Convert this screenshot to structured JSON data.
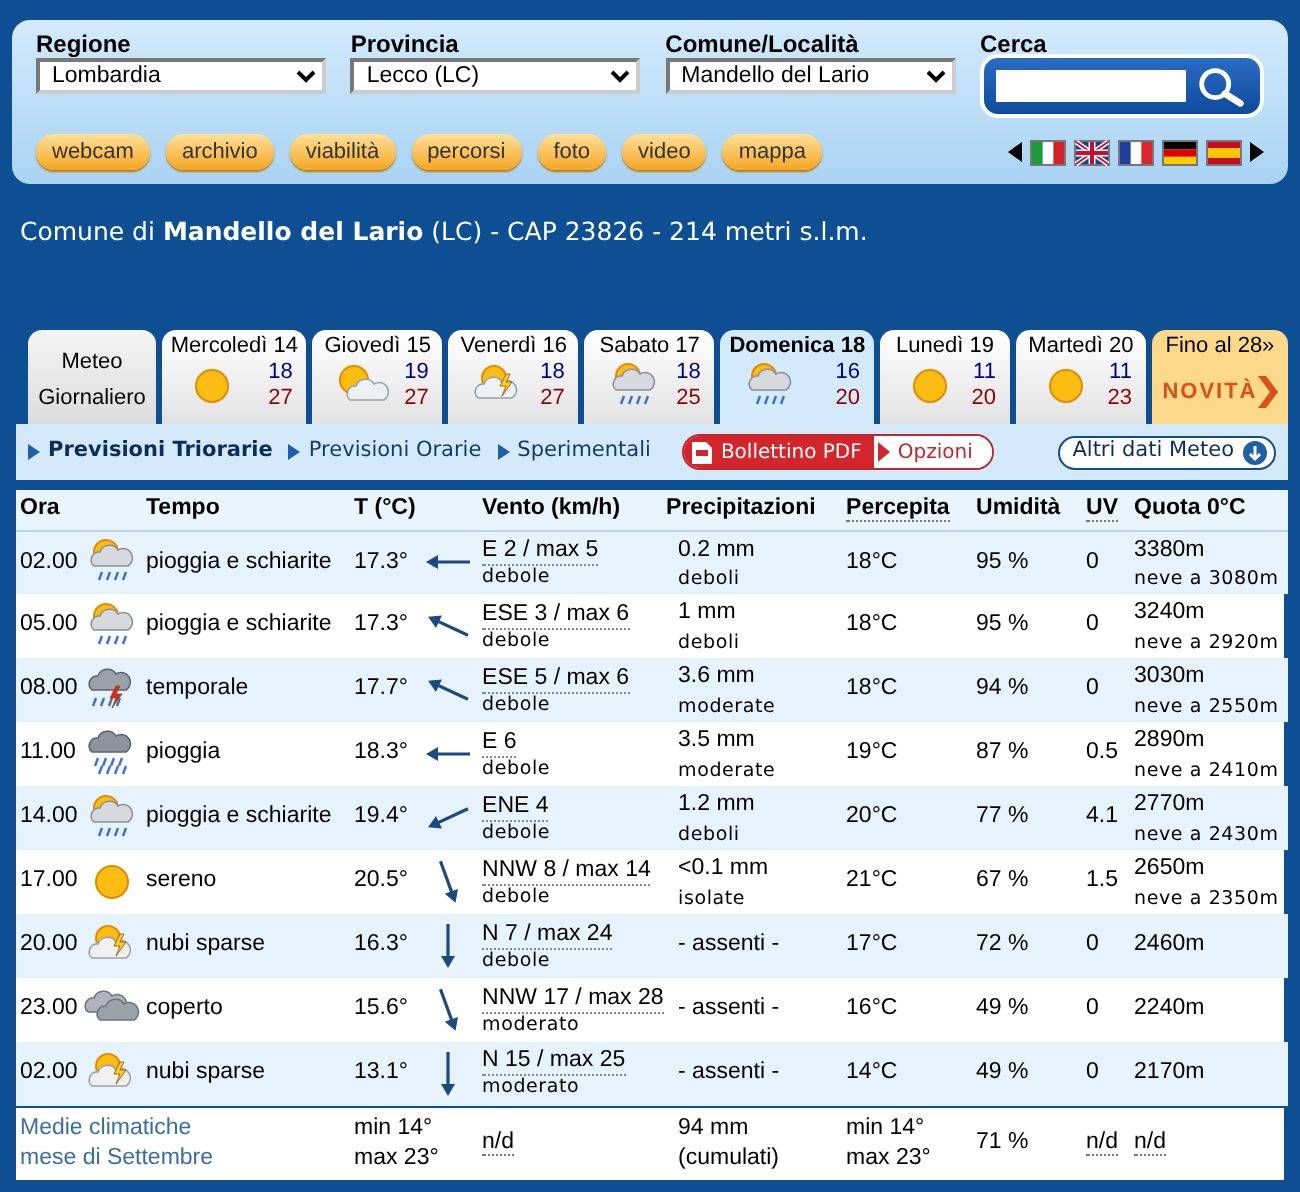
{
  "search_bar": {
    "fields": [
      {
        "label": "Regione",
        "value": "Lombardia"
      },
      {
        "label": "Provincia",
        "value": "Lecco (LC)"
      },
      {
        "label": "Comune/Località",
        "value": "Mandello del Lario"
      }
    ],
    "search": {
      "label": "Cerca"
    }
  },
  "nav_buttons": [
    "webcam",
    "archivio",
    "viabilità",
    "percorsi",
    "foto",
    "video",
    "mappa"
  ],
  "location": "Comune di **Mandello del Lario** (LC) - CAP 23826 - 214 metri s.l.m.",
  "day_tabs": [
    {
      "kind": "label",
      "label": "Meteo Giornaliero",
      "selected": false
    },
    {
      "kind": "sunny",
      "label": "Mercoledì 14",
      "min": "18",
      "max": "27",
      "selected": false
    },
    {
      "kind": "partly",
      "label": "Giovedì 15",
      "min": "19",
      "max": "27",
      "selected": false
    },
    {
      "kind": "sunstorm",
      "label": "Venerdì 16",
      "min": "18",
      "max": "27",
      "selected": false
    },
    {
      "kind": "showers",
      "label": "Sabato 17",
      "min": "18",
      "max": "25",
      "selected": false
    },
    {
      "kind": "showers",
      "label": "Domenica 18",
      "min": "16",
      "max": "20",
      "selected": true
    },
    {
      "kind": "sunny",
      "label": "Lunedì 19",
      "min": "11",
      "max": "20",
      "selected": false
    },
    {
      "kind": "sunny",
      "label": "Martedì 20",
      "min": "11",
      "max": "23",
      "selected": false
    },
    {
      "kind": "promo",
      "label": "Fino al 28»",
      "badge": "NOVITÀ",
      "selected": false
    }
  ],
  "subnav": {
    "links": [
      {
        "label": "Previsioni Triorarie",
        "selected": true
      },
      {
        "label": "Previsioni Orarie",
        "selected": false
      },
      {
        "label": "Sperimentali",
        "selected": false
      }
    ],
    "pdf": "Bollettino PDF",
    "options": "Opzioni",
    "more": "Altri dati Meteo"
  },
  "table": {
    "columns": [
      "Ora",
      "Tempo",
      "T (°C)",
      "Vento (km/h)",
      "Precipitazioni",
      "Percepita",
      "Umidità",
      "UV",
      "Quota 0°C"
    ],
    "rows": [
      {
        "time": "02.00",
        "kind": "showers",
        "weather": "pioggia e schiarite",
        "temp": "17.3°",
        "wind": "E 2 / max 5",
        "wind_desc": "debole",
        "precip": "0.2 mm",
        "precip_desc": "deboli",
        "perceived": "18°C",
        "humidity": "95 %",
        "uv": "0",
        "quota": "3380m",
        "snow": "neve a 3080m"
      },
      {
        "time": "05.00",
        "kind": "showers",
        "weather": "pioggia e schiarite",
        "temp": "17.3°",
        "wind": "ESE 3 / max 6",
        "wind_desc": "debole",
        "precip": "1 mm",
        "precip_desc": "deboli",
        "perceived": "18°C",
        "humidity": "95 %",
        "uv": "0",
        "quota": "3240m",
        "snow": "neve a 2920m"
      },
      {
        "time": "08.00",
        "kind": "thunderstorm",
        "weather": "temporale",
        "temp": "17.7°",
        "wind": "ESE 5 / max 6",
        "wind_desc": "debole",
        "precip": "3.6 mm",
        "precip_desc": "moderate",
        "perceived": "18°C",
        "humidity": "94 %",
        "uv": "0",
        "quota": "3030m",
        "snow": "neve a 2550m"
      },
      {
        "time": "11.00",
        "kind": "rain",
        "weather": "pioggia",
        "temp": "18.3°",
        "wind": "E 6",
        "wind_desc": "debole",
        "precip": "3.5 mm",
        "precip_desc": "moderate",
        "perceived": "19°C",
        "humidity": "87 %",
        "uv": "0.5",
        "quota": "2890m",
        "snow": "neve a 2410m"
      },
      {
        "time": "14.00",
        "kind": "showers",
        "weather": "pioggia e schiarite",
        "temp": "19.4°",
        "wind": "ENE 4",
        "wind_desc": "debole",
        "precip": "1.2 mm",
        "precip_desc": "deboli",
        "perceived": "20°C",
        "humidity": "77 %",
        "uv": "4.1",
        "quota": "2770m",
        "snow": "neve a 2430m"
      },
      {
        "time": "17.00",
        "kind": "sunny",
        "weather": "sereno",
        "temp": "20.5°",
        "wind": "NNW 8 / max 14",
        "wind_desc": "debole",
        "precip": "<0.1 mm",
        "precip_desc": "isolate",
        "perceived": "21°C",
        "humidity": "67 %",
        "uv": "1.5",
        "quota": "2650m",
        "snow": "neve a 2350m"
      },
      {
        "time": "20.00",
        "kind": "sunstorm",
        "weather": "nubi sparse",
        "temp": "16.3°",
        "wind": "N 7 / max 24",
        "wind_desc": "debole",
        "precip": "- assenti -",
        "perceived": "17°C",
        "humidity": "72 %",
        "uv": "0",
        "quota": "2460m"
      },
      {
        "time": "23.00",
        "kind": "overcast",
        "weather": "coperto",
        "temp": "15.6°",
        "wind": "NNW 17 / max 28",
        "wind_desc": "moderato",
        "precip": "- assenti -",
        "perceived": "16°C",
        "humidity": "49 %",
        "uv": "0",
        "quota": "2240m"
      },
      {
        "time": "02.00",
        "kind": "sunstorm",
        "weather": "nubi sparse",
        "temp": "13.1°",
        "wind": "N 15 / max 25",
        "wind_desc": "moderato",
        "precip": "- assenti -",
        "perceived": "14°C",
        "humidity": "49 %",
        "uv": "0",
        "quota": "2170m"
      }
    ],
    "footer": {
      "label": [
        "Medie climatiche",
        "mese di Settembre"
      ],
      "temp": [
        "min 14°",
        "max 23°"
      ],
      "wind": "n/d",
      "precip": [
        "94 mm",
        "(cumulati)"
      ],
      "perceived": [
        "min 14°",
        "max 23°"
      ],
      "humidity": "71 %",
      "uv": "n/d",
      "quota": "n/d"
    }
  }
}
